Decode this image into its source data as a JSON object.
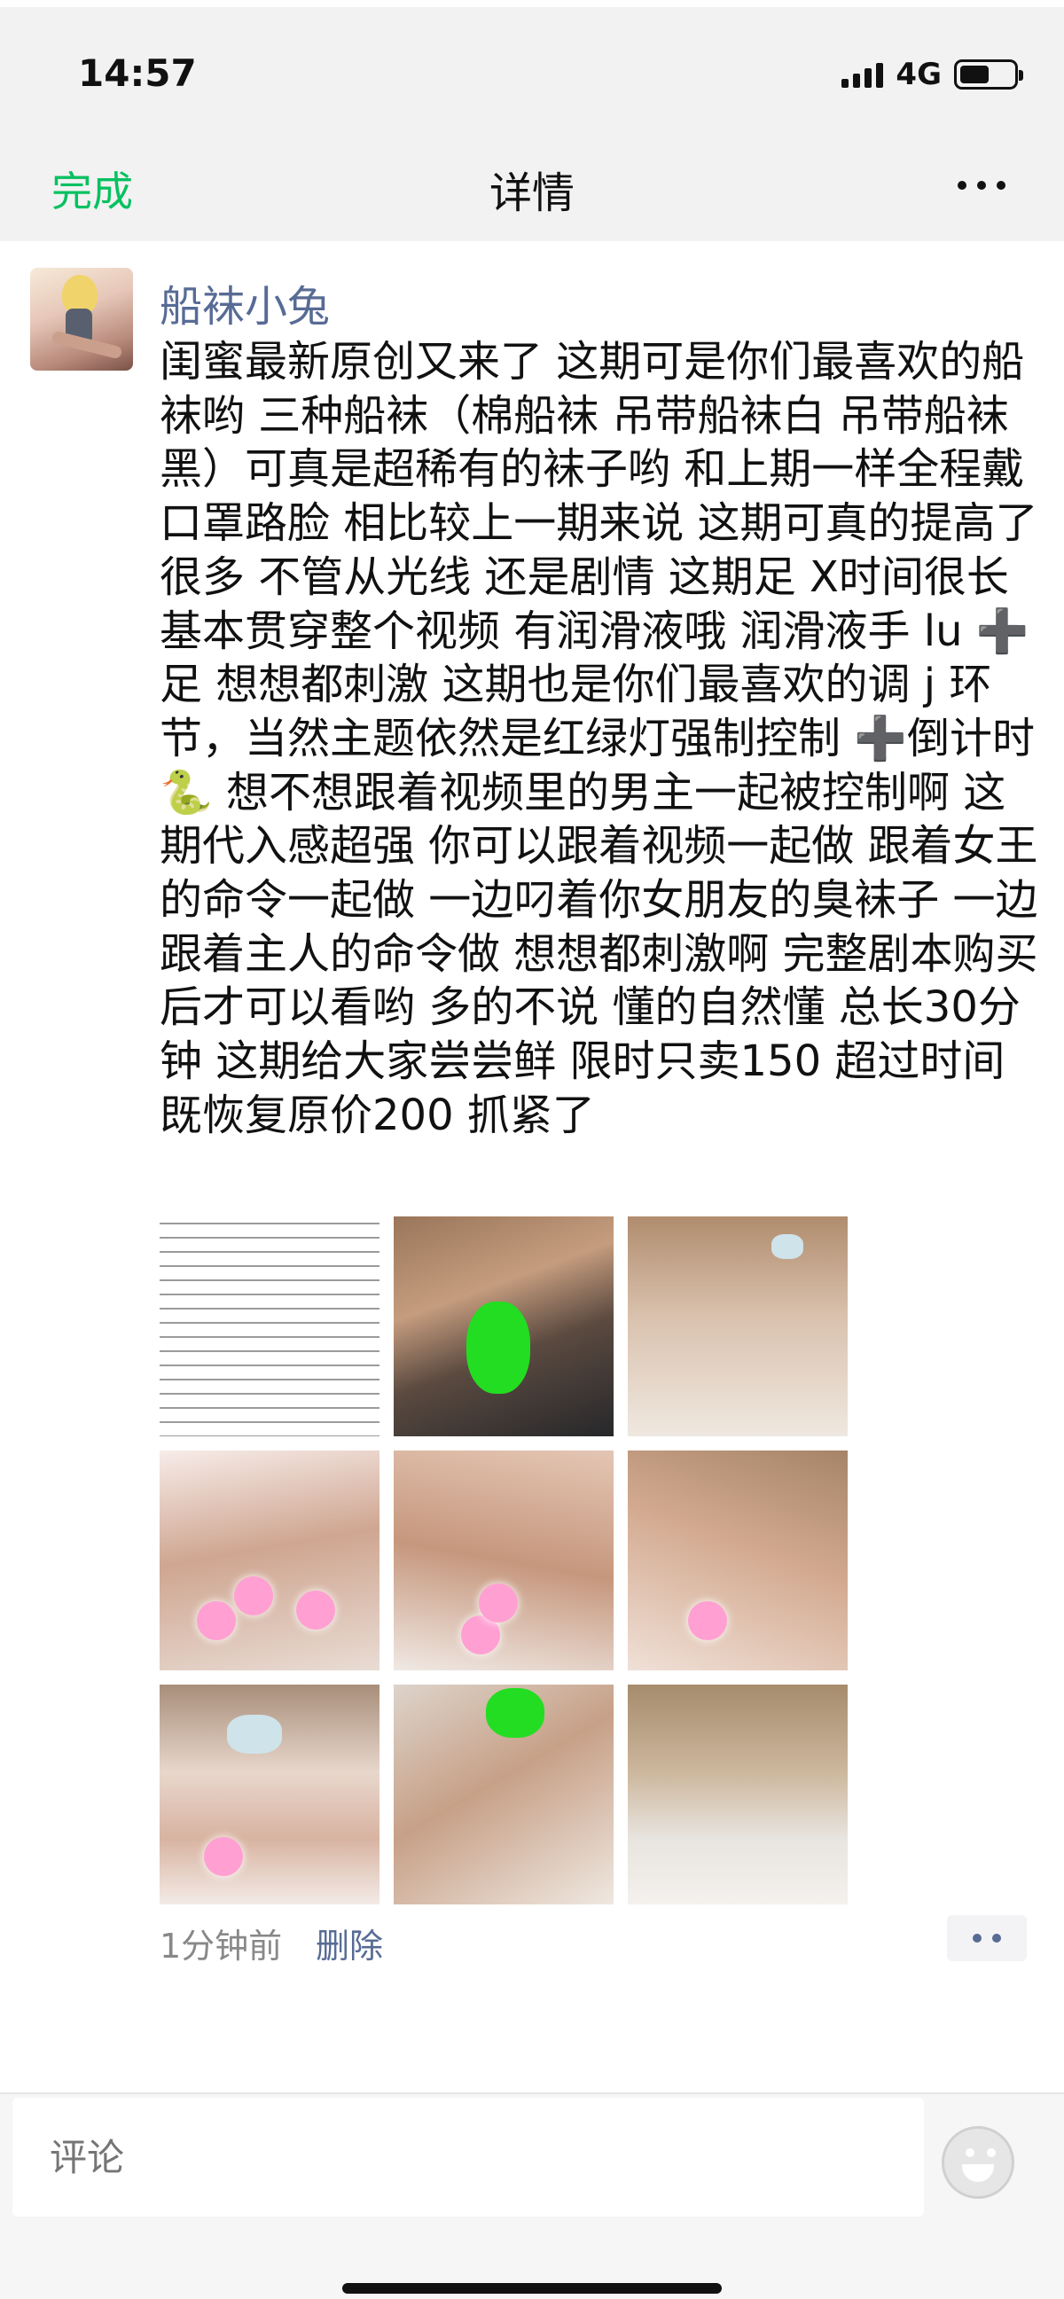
{
  "status_bar": {
    "time": "14:57",
    "network": "4G"
  },
  "nav": {
    "done_label": "完成",
    "title": "详情",
    "more_icon": "more-icon"
  },
  "post": {
    "username": "船袜小兔",
    "text": "闺蜜最新原创又来了 这期可是你们最喜欢的船袜哟 三种船袜（棉船袜 吊带船袜白 吊带船袜黑）可真是超稀有的袜子哟 和上期一样全程戴口罩路脸 相比较上一期来说 这期可真的提高了很多 不管从光线 还是剧情 这期足 X时间很长 基本贯穿整个视频 有润滑液哦 润滑液手 lu ➕足 想想都刺激 这期也是你们最喜欢的调 j 环节，当然主题依然是红绿灯强制控制 ➕倒计时🐍 想不想跟着视频里的男主一起被控制啊 这期代入感超强 你可以跟着视频一起做 跟着女王的命令一起做 一边叼着你女朋友的臭袜子 一边跟着主人的命令做 想想都刺激啊 完整剧本购买后才可以看哟 多的不说 懂的自然懂 总长30分钟 这期给大家尝尝鲜 限时只卖150 超过时间既恢复原价200 抓紧了",
    "time_ago": "1分钟前",
    "delete_label": "删除",
    "photo_count": 9
  },
  "comment": {
    "placeholder": "评论",
    "emoji_icon": "emoji-icon"
  },
  "colors": {
    "accent_green": "#07c160",
    "link_blue": "#576b95"
  }
}
